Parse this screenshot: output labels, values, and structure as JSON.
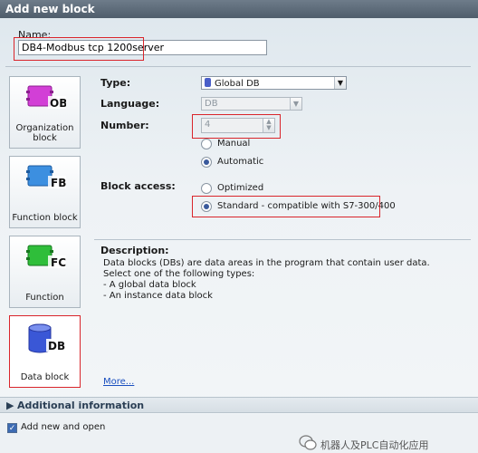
{
  "window": {
    "title": "Add new block"
  },
  "name_field": {
    "label": "Name:",
    "value": "DB4-Modbus tcp 1200server"
  },
  "block_types": [
    {
      "tag": "OB",
      "label_line1": "Organization",
      "label_line2": "block",
      "color": "#d23fd6"
    },
    {
      "tag": "FB",
      "label_line1": "Function block",
      "label_line2": "",
      "color": "#3c8fe0"
    },
    {
      "tag": "FC",
      "label_line1": "Function",
      "label_line2": "",
      "color": "#2fbe3a"
    },
    {
      "tag": "DB",
      "label_line1": "Data block",
      "label_line2": "",
      "color": "#3a57d6"
    }
  ],
  "type_field": {
    "label": "Type:",
    "value": "Global DB"
  },
  "language_field": {
    "label": "Language:",
    "value": "DB"
  },
  "number_field": {
    "label": "Number:",
    "value": "4",
    "options": [
      "Manual",
      "Automatic"
    ],
    "selected": "Automatic"
  },
  "block_access": {
    "label": "Block access:",
    "options": [
      "Optimized",
      "Standard - compatible with S7-300/400"
    ],
    "selected": "Standard - compatible with S7-300/400"
  },
  "description": {
    "title": "Description:",
    "lines": [
      "Data blocks (DBs) are data areas in the program that contain user data.",
      "Select one of the following types:",
      "- A global data block",
      "- An instance data block"
    ],
    "more_link": "More..."
  },
  "additional_info": {
    "label": "Additional  information"
  },
  "footer": {
    "checkbox_label": "Add new and open",
    "checked": true
  },
  "watermark": {
    "text": "机器人及PLC自动化应用"
  }
}
